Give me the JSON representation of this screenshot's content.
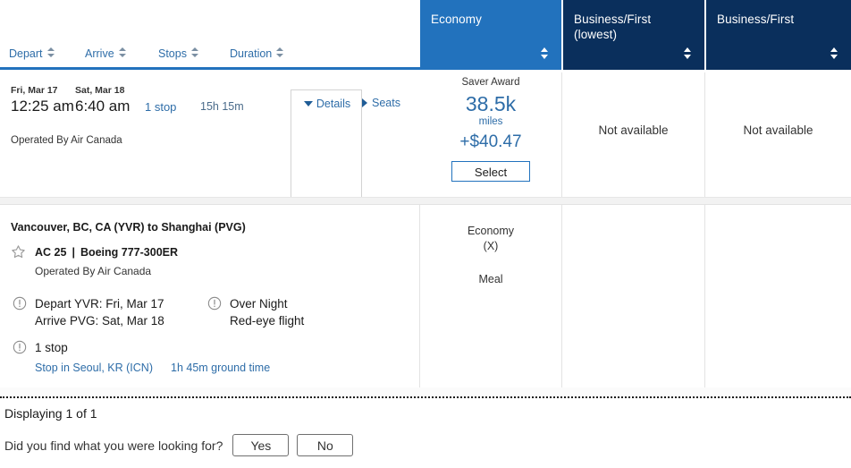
{
  "cabin_columns": [
    {
      "label": "Economy",
      "selected": true,
      "bg": "#2272bd"
    },
    {
      "label": "Business/First\n(lowest)",
      "line1": "Business/First",
      "line2": "(lowest)",
      "selected": false,
      "bg": "#0a2f5c"
    },
    {
      "label": "Business/First",
      "line1": "Business/First",
      "line2": "",
      "selected": false,
      "bg": "#0a2f5c"
    }
  ],
  "sort_bar": {
    "items": [
      {
        "label": "Depart"
      },
      {
        "label": "Arrive"
      },
      {
        "label": "Stops"
      },
      {
        "label": "Duration"
      }
    ]
  },
  "flight": {
    "depart_day": "Fri, Mar 17",
    "depart_time": "12:25 am",
    "arrive_day": "Sat, Mar 18",
    "arrive_time": "6:40 am",
    "stops": "1 stop",
    "duration": "15h 15m",
    "operated_by": "Operated By Air Canada",
    "details_label": "Details",
    "seats_label": "Seats"
  },
  "fares": {
    "economy": {
      "award_type": "Saver Award",
      "miles": "38.5k",
      "miles_unit": "miles",
      "cash": "+$40.47",
      "select_label": "Select"
    },
    "business_lowest": {
      "status": "Not available"
    },
    "business": {
      "status": "Not available"
    }
  },
  "details_panel": {
    "route": "Vancouver, BC, CA (YVR) to Shanghai (PVG)",
    "flight_number": "AC 25",
    "separator": "|",
    "equipment": "Boeing 777-300ER",
    "operated_by": "Operated By Air Canada",
    "depart_info": "Depart YVR: Fri, Mar 17",
    "arrive_info": "Arrive PVG: Sat, Mar 18",
    "overnight_title": "Over Night",
    "overnight_sub": "Red-eye flight",
    "stops_title": "1 stop",
    "stop_city": "Stop in Seoul, KR (ICN)",
    "ground_time": "1h 45m ground time",
    "cabin_name": "Economy",
    "booking_code": "(X)",
    "meal": "Meal"
  },
  "footer": {
    "displaying": "Displaying 1 of 1",
    "feedback_question": "Did you find what you were looking for?",
    "yes_label": "Yes",
    "no_label": "No"
  },
  "colors": {
    "accent_blue": "#2272bd",
    "dark_navy": "#0a2f5c",
    "link_blue": "#2e6da8"
  }
}
